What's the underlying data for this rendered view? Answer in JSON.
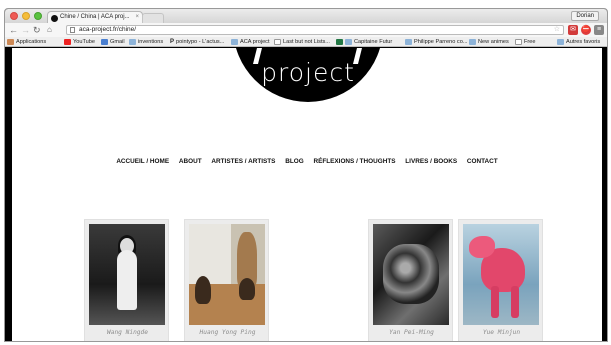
{
  "browser": {
    "tab_title": "Chine / China | ACA proj...",
    "tab_close": "×",
    "user_button": "Dorian",
    "url": "aca-project.fr/chine/",
    "bookmarks": [
      "Applications",
      "YouTube",
      "Gmail",
      "inventions",
      "pointypo - L'actus...",
      "ACA project",
      "Last but not Lists...",
      "Capitaine Futur",
      "Philippe Parreno co...",
      "New animes",
      "Free"
    ],
    "other_bookmarks": "Autres favoris"
  },
  "site": {
    "logo_text": "project",
    "nav": [
      "ACCUEIL / HOME",
      "ABOUT",
      "ARTISTES / ARTISTS",
      "BLOG",
      "RÉFLEXIONS / THOUGHTS",
      "LIVRES / BOOKS",
      "CONTACT"
    ],
    "artists": [
      {
        "name": "Wang Ningde"
      },
      {
        "name": "Huang Yong Ping"
      },
      {
        "name": "Yan Pei-Ming"
      },
      {
        "name": "Yue Minjun"
      }
    ]
  }
}
